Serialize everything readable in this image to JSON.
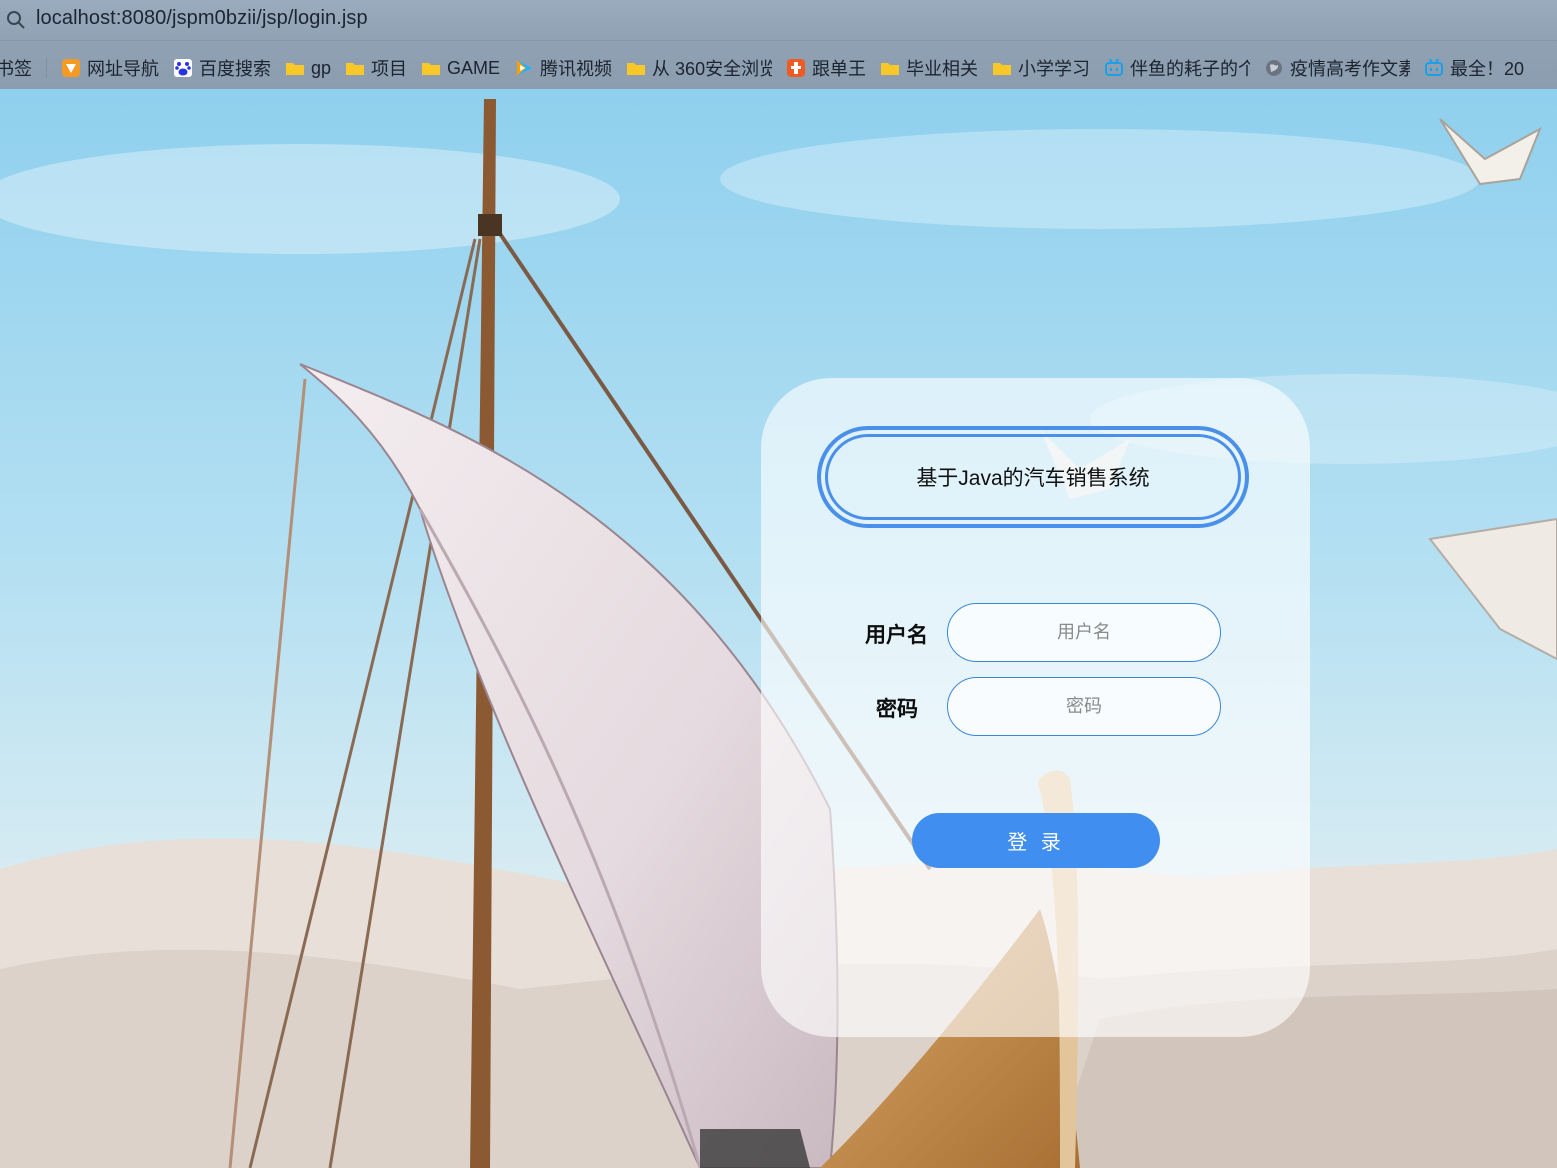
{
  "browser": {
    "url": "localhost:8080/jspm0bzii/jsp/login.jsp",
    "bookmarks_label": "书签",
    "bookmarks": [
      {
        "label": "网址导航",
        "icon": "orange-arrow-icon"
      },
      {
        "label": "百度搜索",
        "icon": "baidu-paw-icon"
      },
      {
        "label": "gp",
        "icon": "folder-icon"
      },
      {
        "label": "项目",
        "icon": "folder-icon"
      },
      {
        "label": "GAME",
        "icon": "folder-icon"
      },
      {
        "label": "腾讯视频",
        "icon": "tencent-video-icon"
      },
      {
        "label": "从 360安全浏览",
        "icon": "folder-icon"
      },
      {
        "label": "跟单王",
        "icon": "orange-badge-icon"
      },
      {
        "label": "毕业相关",
        "icon": "folder-icon"
      },
      {
        "label": "小学学习",
        "icon": "folder-icon"
      },
      {
        "label": "伴鱼的耗子的个",
        "icon": "bilibili-icon"
      },
      {
        "label": "疫情高考作文素",
        "icon": "globe-icon"
      },
      {
        "label": "最全！20",
        "icon": "bilibili-icon"
      }
    ]
  },
  "login": {
    "title": "基于Java的汽车销售系统",
    "username_label": "用户名",
    "username_placeholder": "用户名",
    "username_value": "",
    "password_label": "密码",
    "password_placeholder": "密码",
    "password_value": "",
    "submit_label": "登 录"
  },
  "colors": {
    "accent": "#3f8ef0",
    "title_border": "#4a90ea",
    "input_border": "#3a86d6",
    "sky": "#a9dcf1",
    "sand": "#e6dcd3"
  }
}
